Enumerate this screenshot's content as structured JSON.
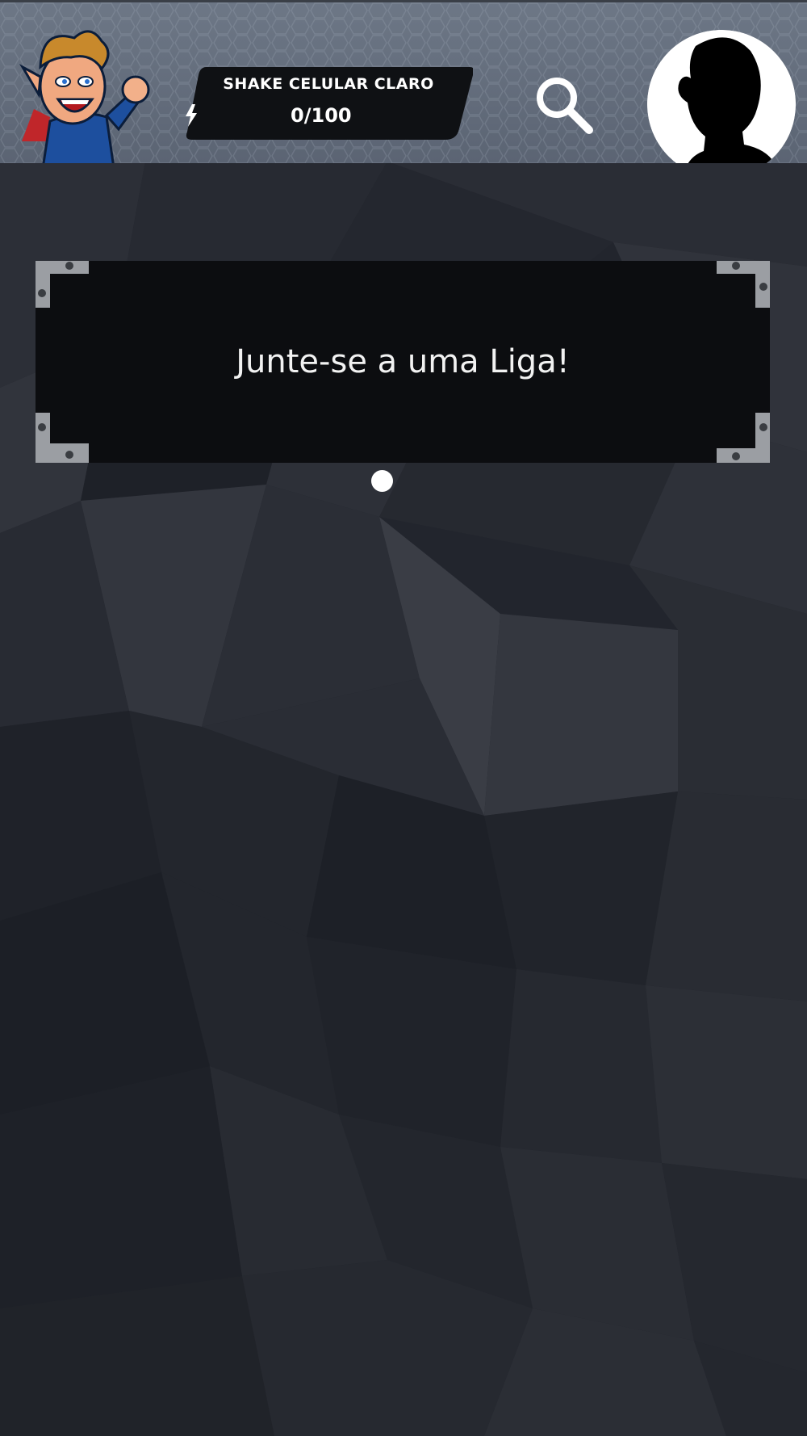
{
  "header": {
    "mascot_icon": "mascot-icon",
    "shake": {
      "title": "SHAKE CELULAR CLARO",
      "count": "0/100",
      "bolt_icon": "lightning-bolt-icon"
    },
    "search_icon": "search-icon",
    "avatar_icon": "silhouette-avatar-icon"
  },
  "main": {
    "league_panel": {
      "text": "Junte-se a uma Liga!"
    },
    "pager": {
      "current": 1,
      "total": 1
    }
  },
  "colors": {
    "header_bg": "#636c7a",
    "page_bg": "#1f222a",
    "panel_bg": "#0c0d10",
    "badge_bg": "#0f1114",
    "text": "#ffffff"
  }
}
